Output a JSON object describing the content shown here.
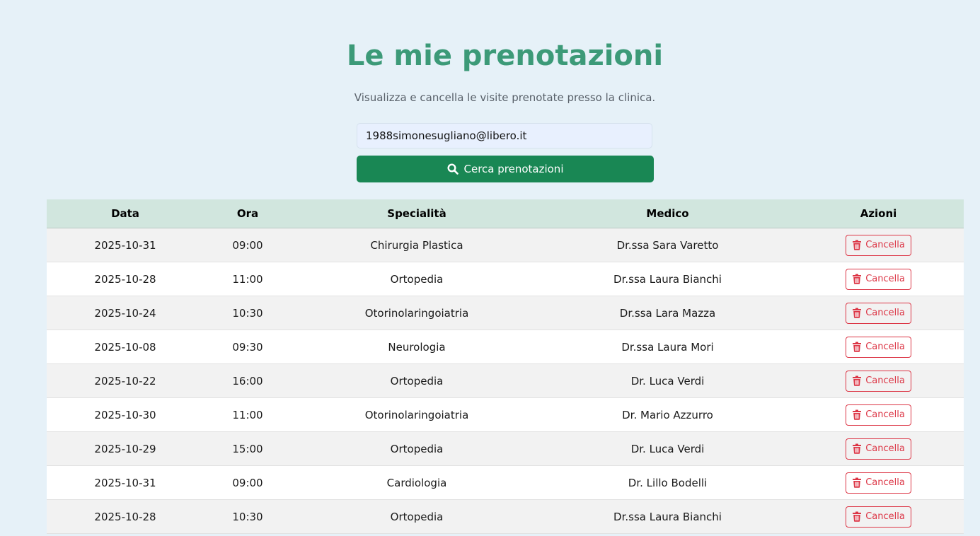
{
  "header": {
    "title": "Le mie prenotazioni",
    "subtitle": "Visualizza e cancella le visite prenotate presso la clinica."
  },
  "search": {
    "email_value": "1988simonesugliano@libero.it",
    "button_label": "Cerca prenotazioni",
    "button_icon": "search-icon"
  },
  "table": {
    "columns": [
      "Data",
      "Ora",
      "Specialità",
      "Medico",
      "Azioni"
    ],
    "cancel_label": "Cancella",
    "cancel_icon": "trash-icon",
    "rows": [
      {
        "data": "2025-10-31",
        "ora": "09:00",
        "specialita": "Chirurgia Plastica",
        "medico": "Dr.ssa Sara Varetto"
      },
      {
        "data": "2025-10-28",
        "ora": "11:00",
        "specialita": "Ortopedia",
        "medico": "Dr.ssa Laura Bianchi"
      },
      {
        "data": "2025-10-24",
        "ora": "10:30",
        "specialita": "Otorinolaringoiatria",
        "medico": "Dr.ssa Lara Mazza"
      },
      {
        "data": "2025-10-08",
        "ora": "09:30",
        "specialita": "Neurologia",
        "medico": "Dr.ssa Laura Mori"
      },
      {
        "data": "2025-10-22",
        "ora": "16:00",
        "specialita": "Ortopedia",
        "medico": "Dr. Luca Verdi"
      },
      {
        "data": "2025-10-30",
        "ora": "11:00",
        "specialita": "Otorinolaringoiatria",
        "medico": "Dr. Mario Azzurro"
      },
      {
        "data": "2025-10-29",
        "ora": "15:00",
        "specialita": "Ortopedia",
        "medico": "Dr. Luca Verdi"
      },
      {
        "data": "2025-10-31",
        "ora": "09:00",
        "specialita": "Cardiologia",
        "medico": "Dr. Lillo Bodelli"
      },
      {
        "data": "2025-10-28",
        "ora": "10:30",
        "specialita": "Ortopedia",
        "medico": "Dr.ssa Laura Bianchi"
      }
    ]
  },
  "colors": {
    "background": "#e6f1f8",
    "title": "#3c9a78",
    "primary_button": "#198754",
    "danger": "#dc3545",
    "table_header": "#d1e6de"
  }
}
